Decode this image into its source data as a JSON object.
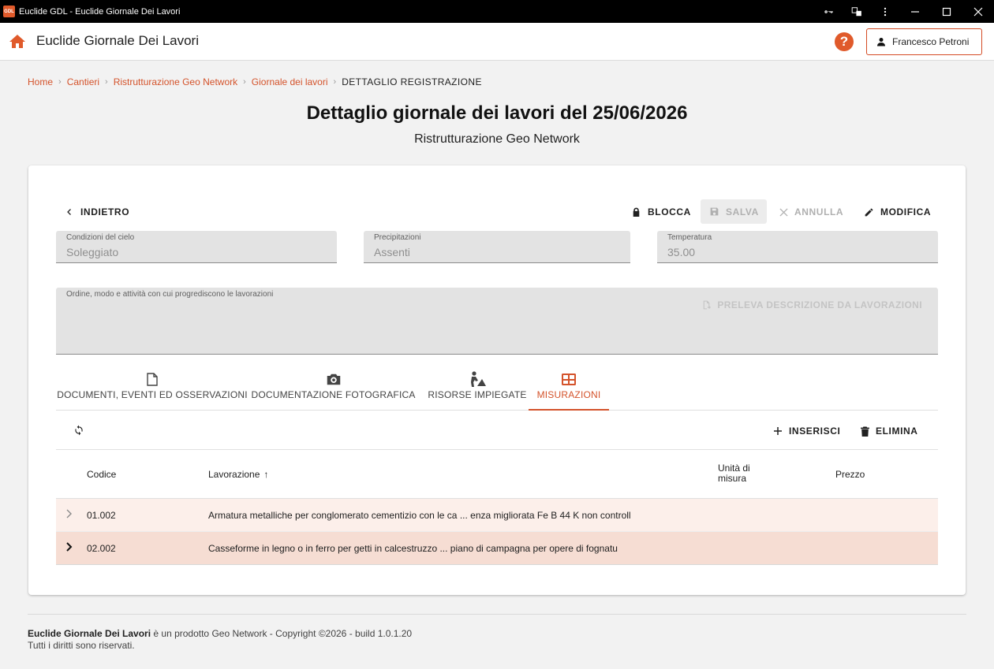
{
  "window": {
    "logo_text": "GDL",
    "title": "Euclide GDL - Euclide Giornale Dei Lavori"
  },
  "appbar": {
    "title": "Euclide Giornale Dei Lavori",
    "help_label": "?",
    "user_name": "Francesco Petroni"
  },
  "breadcrumb": {
    "items": [
      "Home",
      "Cantieri",
      "Ristrutturazione Geo Network",
      "Giornale dei lavori"
    ],
    "separator": "›",
    "current": "DETTAGLIO REGISTRAZIONE"
  },
  "page": {
    "title": "Dettaglio giornale dei lavori del 25/06/2026",
    "subtitle": "Ristrutturazione Geo Network"
  },
  "actions": {
    "back": "INDIETRO",
    "lock": "BLOCCA",
    "save": "SALVA",
    "cancel": "ANNULLA",
    "edit": "MODIFICA"
  },
  "fields": {
    "sky": {
      "label": "Condizioni del cielo",
      "value": "Soleggiato"
    },
    "rain": {
      "label": "Precipitazioni",
      "value": "Assenti"
    },
    "temp": {
      "label": "Temperatura",
      "value": "35.00"
    },
    "progress": {
      "label": "Ordine, modo e attività con cui progrediscono le lavorazioni",
      "action": "PRELEVA DESCRIZIONE DA LAVORAZIONI"
    }
  },
  "tabs": [
    {
      "label": "DOCUMENTI, EVENTI ED OSSERVAZIONI",
      "icon": "document-icon"
    },
    {
      "label": "DOCUMENTAZIONE FOTOGRAFICA",
      "icon": "camera-icon"
    },
    {
      "label": "RISORSE IMPIEGATE",
      "icon": "worker-icon"
    },
    {
      "label": "MISURAZIONI",
      "icon": "table-icon",
      "active": true
    }
  ],
  "toolbar": {
    "insert": "INSERISCI",
    "delete": "ELIMINA"
  },
  "table": {
    "columns": [
      "Codice",
      "Lavorazione",
      "Unità di\nmisura",
      "Prezzo"
    ],
    "sort_indicator": "↑",
    "rows": [
      {
        "code": "01.002",
        "description": "Armatura metalliche per conglomerato cementizio con le ca ... enza migliorata Fe B 44 K non controll",
        "background": "#fcefea"
      },
      {
        "code": "02.002",
        "description": "Casseforme in legno o in ferro per getti in calcestruzzo ... piano di campagna per opere di fognatu",
        "background": "#f6ddd3"
      }
    ]
  },
  "footer": {
    "product": "Euclide Giornale Dei Lavori",
    "text": " è un prodotto Geo Network - Copyright ©2026 - build 1.0.1.20",
    "rights": "Tutti i diritti sono riservati."
  },
  "colors": {
    "accent": "#d4532b",
    "titlebar": "#000000",
    "field_bg": "#e3e3e3"
  }
}
